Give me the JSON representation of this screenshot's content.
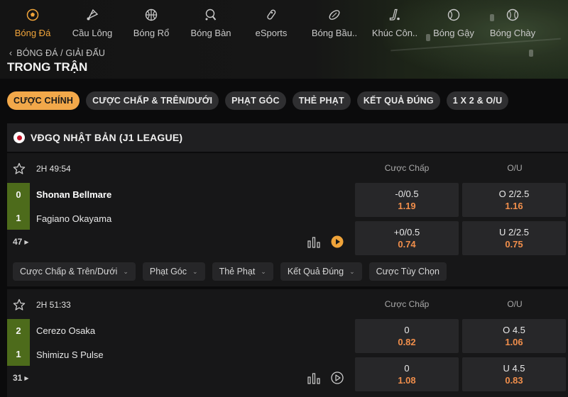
{
  "colors": {
    "accent": "#f0a43a",
    "odds_price": "#f08e4b",
    "score_green": "#4d6b1b"
  },
  "sports_nav": [
    {
      "label": "Bóng Đá",
      "icon": "soccer-ball-icon",
      "active": true
    },
    {
      "label": "Cầu Lông",
      "icon": "shuttlecock-icon",
      "active": false
    },
    {
      "label": "Bóng Rổ",
      "icon": "basketball-icon",
      "active": false
    },
    {
      "label": "Bóng Bàn",
      "icon": "table-tennis-icon",
      "active": false
    },
    {
      "label": "eSports",
      "icon": "esports-icon",
      "active": false
    },
    {
      "label": "Bóng Bầu..",
      "icon": "american-football-icon",
      "active": false
    },
    {
      "label": "Khúc Côn..",
      "icon": "hockey-stick-icon",
      "active": false
    },
    {
      "label": "Bóng Gậy",
      "icon": "cricket-ball-icon",
      "active": false
    },
    {
      "label": "Bóng Chày",
      "icon": "baseball-icon",
      "active": false
    }
  ],
  "breadcrumb": "BÓNG ĐÁ / GIẢI ĐẤU",
  "page_title": "TRONG TRẬN",
  "filters": [
    {
      "label": "CƯỢC CHÍNH",
      "active": true
    },
    {
      "label": "CƯỢC CHẤP & TRÊN/DƯỚI",
      "active": false
    },
    {
      "label": "PHẠT GÓC",
      "active": false
    },
    {
      "label": "THẺ PHẠT",
      "active": false
    },
    {
      "label": "KẾT QUẢ ĐÚNG",
      "active": false
    },
    {
      "label": "1 X 2 & O/U",
      "active": false
    }
  ],
  "league": {
    "name": "VĐGQ NHẬT BẢN (J1 LEAGUE)",
    "flag": "japan-flag-icon"
  },
  "matches": [
    {
      "time": "2H 49:54",
      "col_handicap": "Cược Chấp",
      "col_ou": "O/U",
      "home": {
        "score": "0",
        "name": "Shonan Bellmare"
      },
      "away": {
        "score": "1",
        "name": "Fagiano Okayama"
      },
      "handicap": [
        {
          "line": "-0/0.5",
          "price": "1.19"
        },
        {
          "line": "+0/0.5",
          "price": "0.74"
        }
      ],
      "ou": [
        {
          "line": "O 2/2.5",
          "price": "1.16"
        },
        {
          "line": "U 2/2.5",
          "price": "0.75"
        }
      ],
      "more_count": "47",
      "subtabs": [
        "Cược Chấp & Trên/Dưới",
        "Phạt Góc",
        "Thẻ Phạt",
        "Kết Quả Đúng",
        "Cược Tùy Chọn"
      ]
    },
    {
      "time": "2H 51:33",
      "col_handicap": "Cược Chấp",
      "col_ou": "O/U",
      "home": {
        "score": "2",
        "name": "Cerezo Osaka"
      },
      "away": {
        "score": "1",
        "name": "Shimizu S Pulse"
      },
      "handicap": [
        {
          "line": "0",
          "price": "0.82"
        },
        {
          "line": "0",
          "price": "1.08"
        }
      ],
      "ou": [
        {
          "line": "O 4.5",
          "price": "1.06"
        },
        {
          "line": "U 4.5",
          "price": "0.83"
        }
      ],
      "more_count": "31"
    }
  ]
}
